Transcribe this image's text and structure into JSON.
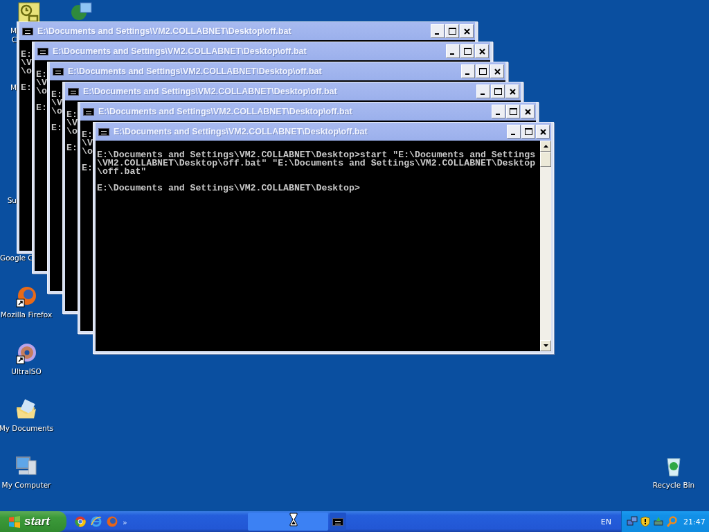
{
  "desktop_icons": [
    {
      "label_lines": [
        "M",
        "C"
      ]
    },
    {
      "label_lines": [
        "M"
      ]
    },
    {
      "label_lines": [
        "Su"
      ]
    },
    {
      "label_lines": [
        "Google C"
      ]
    },
    {
      "label_lines": [
        "Mozilla Firefox"
      ]
    },
    {
      "label_lines": [
        "UltraISO"
      ]
    },
    {
      "label_lines": [
        "My Documents"
      ]
    },
    {
      "label_lines": [
        "My Computer"
      ]
    },
    {
      "label_lines": [
        "Recycle Bin"
      ]
    }
  ],
  "windows": [
    {
      "title": "E:\\Documents and Settings\\VM2.COLLABNET\\Desktop\\off.bat",
      "output": [
        "E:",
        "\\V",
        "\\o"
      ],
      "prompt": "E:"
    },
    {
      "title": "E:\\Documents and Settings\\VM2.COLLABNET\\Desktop\\off.bat",
      "output": [
        "E:",
        "\\V",
        "\\o"
      ],
      "prompt": "E:"
    },
    {
      "title": "E:\\Documents and Settings\\VM2.COLLABNET\\Desktop\\off.bat",
      "output": [
        "E:",
        "\\V",
        "\\o"
      ],
      "prompt": "E:"
    },
    {
      "title": "E:\\Documents and Settings\\VM2.COLLABNET\\Desktop\\off.bat",
      "output": [
        "E:",
        "\\V",
        "\\o"
      ],
      "prompt": "E:"
    },
    {
      "title": "E:\\Documents and Settings\\VM2.COLLABNET\\Desktop\\off.bat",
      "output": [
        "E:",
        "\\V",
        "\\o"
      ],
      "prompt": "E:"
    },
    {
      "title": "E:\\Documents and Settings\\VM2.COLLABNET\\Desktop\\off.bat",
      "output": [
        "E:\\Documents and Settings\\VM2.COLLABNET\\Desktop>start \"E:\\Documents and Settings",
        "\\VM2.COLLABNET\\Desktop\\off.bat\" \"E:\\Documents and Settings\\VM2.COLLABNET\\Desktop",
        "\\off.bat\""
      ],
      "prompt": "E:\\Documents and Settings\\VM2.COLLABNET\\Desktop>",
      "scrollbar": true
    }
  ],
  "taskbar": {
    "start_label": "start",
    "more": "»",
    "task_buttons": [
      {
        "kind": "blank"
      },
      {
        "kind": "console"
      }
    ],
    "language": "EN",
    "clock": "21:47"
  }
}
